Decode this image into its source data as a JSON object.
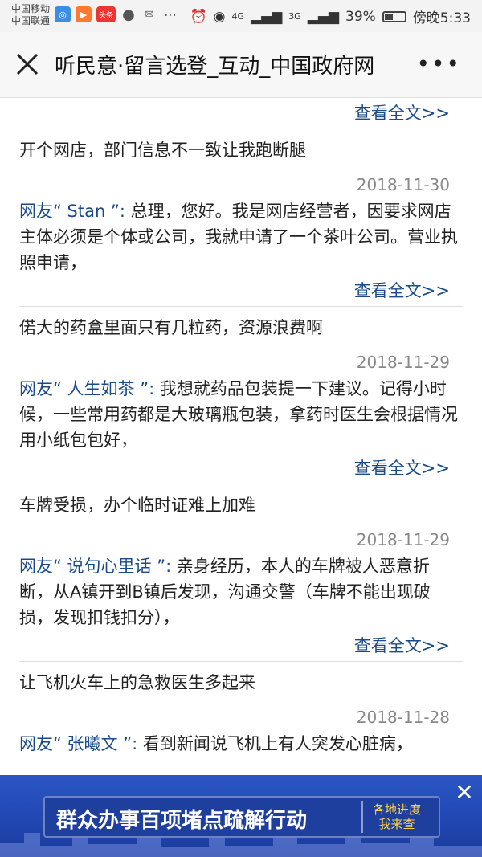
{
  "status_bar": {
    "carrier_1": "中国移动",
    "carrier_2": "中国联通",
    "app_badge": "头条",
    "network_1": "4G",
    "network_2": "3G",
    "battery": "39%",
    "time": "傍晚5:33"
  },
  "titlebar": {
    "title": "听民意·留言选登_互动_中国政府网"
  },
  "more_link_label": "查看全文>>",
  "items": [
    {
      "title": "开个网店，部门信息不一致让我跑断腿",
      "date": "2018-11-30",
      "user": "网友“ Stan ”:",
      "body": " 总理，您好。我是网店经营者，因要求网店主体必须是个体或公司，我就申请了一个茶叶公司。营业执照申请，"
    },
    {
      "title": "偌大的药盒里面只有几粒药，资源浪费啊",
      "date": "2018-11-29",
      "user": "网友“ 人生如茶 ”:",
      "body": " 我想就药品包装提一下建议。记得小时候，一些常用药都是大玻璃瓶包装，拿药时医生会根据情况用小纸包包好，"
    },
    {
      "title": "车牌受损，办个临时证难上加难",
      "date": "2018-11-29",
      "user": "网友“ 说句心里话 ”:",
      "body": " 亲身经历，本人的车牌被人恶意折断，从A镇开到B镇后发现，沟通交警（车牌不能出现破损，发现扣钱扣分），"
    },
    {
      "title": "让飞机火车上的急救医生多起来",
      "date": "2018-11-28",
      "user": "网友“ 张曦文 ”:",
      "body": " 看到新闻说飞机上有人突发心脏病，"
    }
  ],
  "banner": {
    "text": "群众办事百项堵点疏解行动",
    "tag_line1": "各地进度",
    "tag_line2": "我来查"
  },
  "colors": {
    "link": "#1a4a8a",
    "banner_bg": "#2046b0",
    "banner_tag": "#ffd24a"
  }
}
